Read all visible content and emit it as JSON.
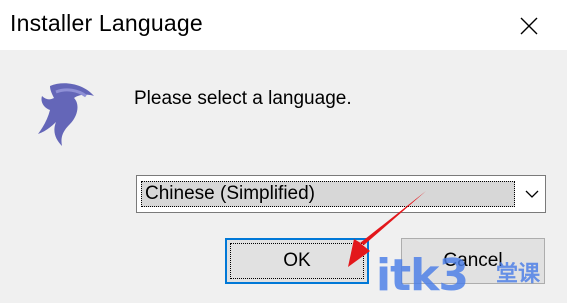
{
  "window": {
    "title": "Installer Language",
    "close_icon": "close-icon"
  },
  "dialog": {
    "logo_icon": "dolphin-icon",
    "prompt": "Please select a language.",
    "language_select": {
      "selected": "Chinese (Simplified)",
      "arrow_icon": "chevron-down-icon"
    },
    "buttons": {
      "ok": "OK",
      "cancel": "Cancel"
    }
  },
  "overlay": {
    "watermark": "itk3",
    "watermark_suffix": "堂课",
    "arrow_color": "#e3171b",
    "watermark_color": "#4a7ee8"
  }
}
